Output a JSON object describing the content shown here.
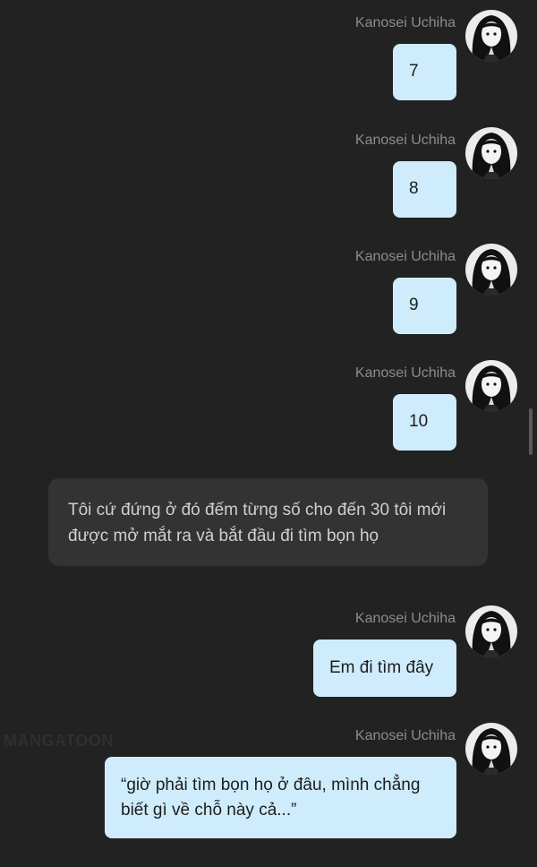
{
  "conversation": {
    "messages": [
      {
        "sender": "Kanosei Uchiha",
        "text": "7"
      },
      {
        "sender": "Kanosei Uchiha",
        "text": "8"
      },
      {
        "sender": "Kanosei Uchiha",
        "text": "9"
      },
      {
        "sender": "Kanosei Uchiha",
        "text": "10"
      },
      {
        "sender": "Kanosei Uchiha",
        "text": "Em đi tìm đây"
      },
      {
        "sender": "Kanosei Uchiha",
        "text": "“giờ phải tìm bọn họ ở đâu, mình chẳng biết gì về chỗ này cả...”"
      }
    ],
    "narration": "Tôi cứ đứng ở đó đếm từng số cho đến 30 tôi mới được mở mắt ra và bắt đầu đi tìm bọn họ"
  },
  "watermark": "MANGATOON",
  "colors": {
    "background": "#222222",
    "user_bubble": "#cfecfc",
    "narration_bubble": "#333333",
    "sender_name": "#8c8c8c"
  },
  "icons": {
    "avatar": "avatar-image"
  }
}
